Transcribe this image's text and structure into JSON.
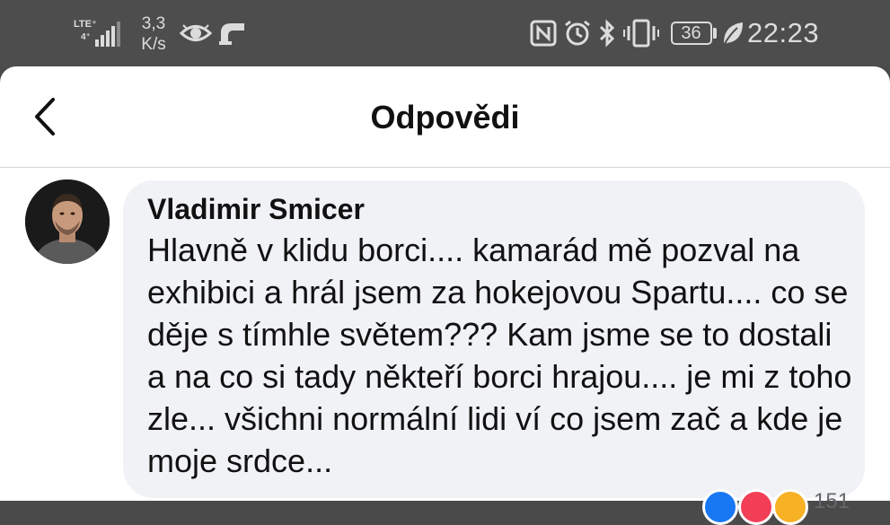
{
  "status_bar": {
    "network_label": "LTE⁺",
    "network_sub": "4⁺",
    "speed_value": "3,3",
    "speed_unit": "K/s",
    "battery_level": "36",
    "time": "22:23",
    "icons": [
      "signal-icon",
      "eye-icon",
      "vpn-icon",
      "nfc-icon",
      "alarm-icon",
      "bluetooth-icon",
      "vibrate-icon",
      "battery-icon",
      "leaf-icon"
    ],
    "color": "#dcdcdc"
  },
  "header": {
    "title": "Odpovědi",
    "back_icon": "chevron-left-icon"
  },
  "comment": {
    "author": "Vladimir Smicer",
    "text": "Hlavně v klidu borci.... kamarád mě pozval na exhibici a hrál jsem za hokejovou Spartu.... co se děje s tímhle světem??? Kam jsme se to dostali a na co si tady někteří borci hrajou.... je mi z toho zle... všichni normální lidi ví co jsem zač a kde je moje srdce...",
    "bubble_color": "#f0f2f5"
  },
  "reactions": {
    "types": [
      "like-icon",
      "love-icon",
      "haha-icon"
    ],
    "count": "151"
  },
  "colors": {
    "status_bar_bg": "#4d4d4d",
    "like": "#1877f2",
    "love": "#f33e58",
    "haha": "#f7b125"
  }
}
